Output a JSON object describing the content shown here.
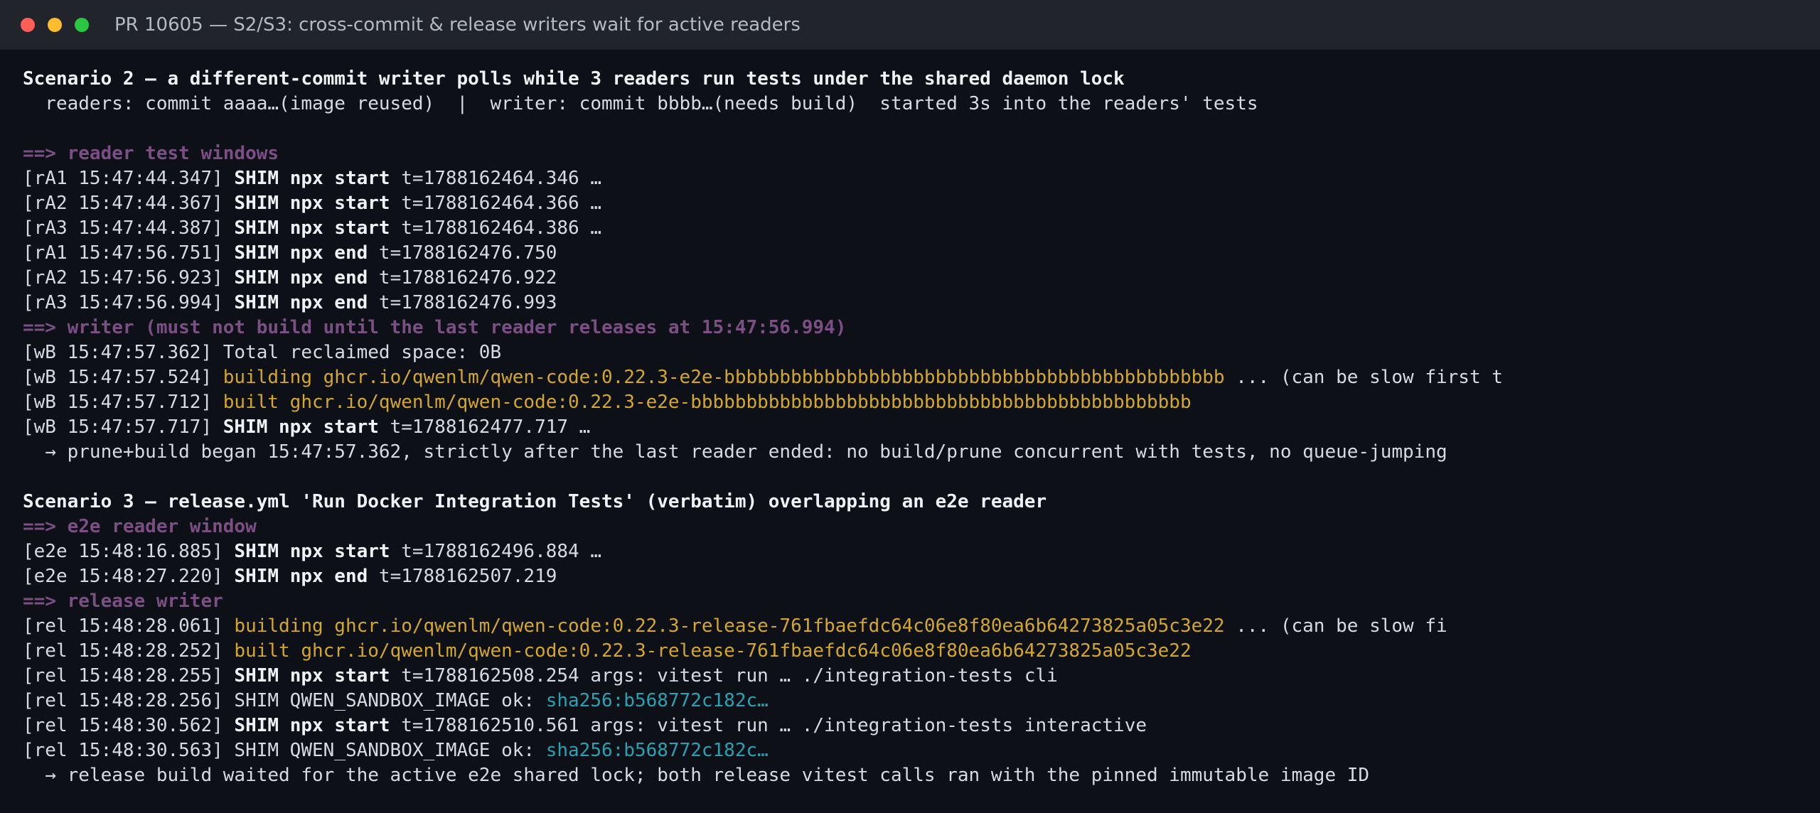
{
  "window": {
    "title": "PR 10605 — S2/S3: cross-commit & release writers wait for active readers"
  },
  "colors": {
    "background": "#0d1117",
    "titlebar": "#21252b",
    "text": "#d7dae0",
    "bold_text": "#f0f2f5",
    "header_purple": "#7c4f84",
    "build_yellow": "#d4a72c",
    "hash_cyan": "#2aa1b3",
    "close_light": "#ff5f57",
    "minimize_light": "#febc2e",
    "maximize_light": "#28c840"
  },
  "icons": {
    "close": "close-traffic-light-icon",
    "minimize": "minimize-traffic-light-icon",
    "maximize": "maximize-traffic-light-icon"
  },
  "terminal": {
    "s2_title": "Scenario 2 — a different-commit writer polls while 3 readers run tests under the shared daemon lock",
    "s2_subtitle": "  readers: commit aaaa…(image reused)  |  writer: commit bbbb…(needs build)  started 3s into the readers' tests",
    "s2_h1": "==> reader test windows",
    "s2_l1": {
      "prefix": "[rA1 15:47:44.347] ",
      "bold": "SHIM npx start",
      "rest": " t=1788162464.346 …"
    },
    "s2_l2": {
      "prefix": "[rA2 15:47:44.367] ",
      "bold": "SHIM npx start",
      "rest": " t=1788162464.366 …"
    },
    "s2_l3": {
      "prefix": "[rA3 15:47:44.387] ",
      "bold": "SHIM npx start",
      "rest": " t=1788162464.386 …"
    },
    "s2_l4": {
      "prefix": "[rA1 15:47:56.751] ",
      "bold": "SHIM npx end",
      "rest": " t=1788162476.750"
    },
    "s2_l5": {
      "prefix": "[rA2 15:47:56.923] ",
      "bold": "SHIM npx end",
      "rest": " t=1788162476.922"
    },
    "s2_l6": {
      "prefix": "[rA3 15:47:56.994] ",
      "bold": "SHIM npx end",
      "rest": " t=1788162476.993"
    },
    "s2_h2": "==> writer (must not build until the last reader releases at 15:47:56.994)",
    "s2_l7": "[wB 15:47:57.362] Total reclaimed space: 0B",
    "s2_l8": {
      "prefix": "[wB 15:47:57.524] ",
      "yellow": "building ghcr.io/qwenlm/qwen-code:0.22.3-e2e-bbbbbbbbbbbbbbbbbbbbbbbbbbbbbbbbbbbbbbbbbbbbb",
      "rest": " ... (can be slow first t"
    },
    "s2_l9": {
      "prefix": "[wB 15:47:57.712] ",
      "yellow": "built ghcr.io/qwenlm/qwen-code:0.22.3-e2e-bbbbbbbbbbbbbbbbbbbbbbbbbbbbbbbbbbbbbbbbbbbbb"
    },
    "s2_l10": {
      "prefix": "[wB 15:47:57.717] ",
      "bold": "SHIM npx start",
      "rest": " t=1788162477.717 …"
    },
    "s2_note": "  → prune+build began 15:47:57.362, strictly after the last reader ended: no build/prune concurrent with tests, no queue-jumping",
    "s3_title": "Scenario 3 — release.yml 'Run Docker Integration Tests' (verbatim) overlapping an e2e reader",
    "s3_h1": "==> e2e reader window",
    "s3_l1": {
      "prefix": "[e2e 15:48:16.885] ",
      "bold": "SHIM npx start",
      "rest": " t=1788162496.884 …"
    },
    "s3_l2": {
      "prefix": "[e2e 15:48:27.220] ",
      "bold": "SHIM npx end",
      "rest": " t=1788162507.219"
    },
    "s3_h2": "==> release writer",
    "s3_l3": {
      "prefix": "[rel 15:48:28.061] ",
      "yellow": "building ghcr.io/qwenlm/qwen-code:0.22.3-release-761fbaefdc64c06e8f80ea6b64273825a05c3e22",
      "rest": " ... (can be slow fi"
    },
    "s3_l4": {
      "prefix": "[rel 15:48:28.252] ",
      "yellow": "built ghcr.io/qwenlm/qwen-code:0.22.3-release-761fbaefdc64c06e8f80ea6b64273825a05c3e22"
    },
    "s3_l5": {
      "prefix": "[rel 15:48:28.255] ",
      "bold": "SHIM npx start",
      "rest": " t=1788162508.254 args: vitest run … ./integration-tests cli"
    },
    "s3_l6": {
      "prefix": "[rel 15:48:28.256] SHIM QWEN_SANDBOX_IMAGE ok: ",
      "cyan": "sha256:b568772c182c…"
    },
    "s3_l7": {
      "prefix": "[rel 15:48:30.562] ",
      "bold": "SHIM npx start",
      "rest": " t=1788162510.561 args: vitest run … ./integration-tests interactive"
    },
    "s3_l8": {
      "prefix": "[rel 15:48:30.563] SHIM QWEN_SANDBOX_IMAGE ok: ",
      "cyan": "sha256:b568772c182c…"
    },
    "s3_note": "  → release build waited for the active e2e shared lock; both release vitest calls ran with the pinned immutable image ID"
  }
}
